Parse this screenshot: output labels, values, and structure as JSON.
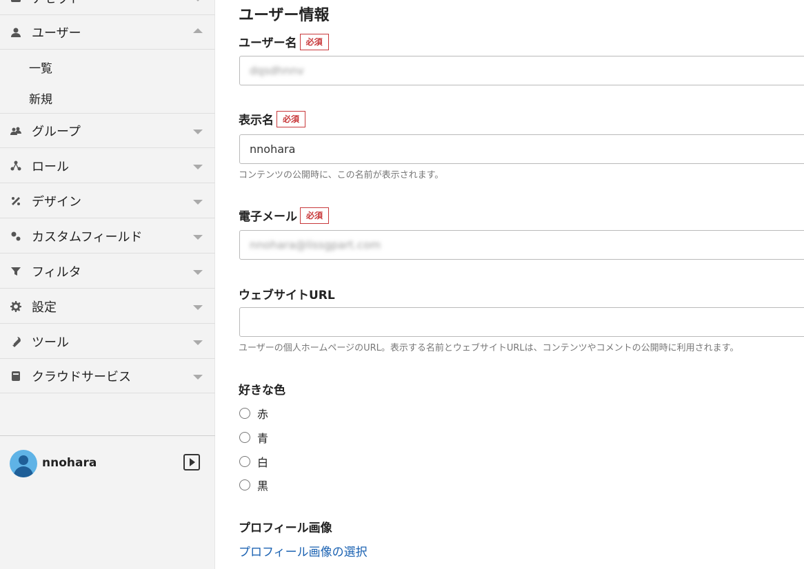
{
  "sidebar": {
    "top_item": {
      "label": "アセット"
    },
    "users": {
      "label": "ユーザー",
      "sub": [
        "一覧",
        "新規"
      ]
    },
    "items": [
      {
        "label": "グループ",
        "icon": "group-icon"
      },
      {
        "label": "ロール",
        "icon": "role-icon"
      },
      {
        "label": "デザイン",
        "icon": "design-icon"
      },
      {
        "label": "カスタムフィールド",
        "icon": "custom-field-icon"
      },
      {
        "label": "フィルタ",
        "icon": "filter-icon"
      },
      {
        "label": "設定",
        "icon": "gear-icon"
      },
      {
        "label": "ツール",
        "icon": "wrench-icon"
      },
      {
        "label": "クラウドサービス",
        "icon": "cloud-service-icon"
      }
    ],
    "user": {
      "name": "nnohara"
    }
  },
  "main": {
    "section_title": "ユーザー情報",
    "required_badge": "必須",
    "username": {
      "label": "ユーザー名",
      "value": "dqsdhnnv"
    },
    "display_name": {
      "label": "表示名",
      "value": "nnohara",
      "help": "コンテンツの公開時に、この名前が表示されます。"
    },
    "email": {
      "label": "電子メール",
      "value": "nnohara@lissgpart.com"
    },
    "website": {
      "label": "ウェブサイトURL",
      "value": "",
      "help": "ユーザーの個人ホームページのURL。表示する名前とウェブサイトURLは、コンテンツやコメントの公開時に利用されます。"
    },
    "color": {
      "label": "好きな色",
      "options": [
        "赤",
        "青",
        "白",
        "黒"
      ]
    },
    "profile_image": {
      "label": "プロフィール画像",
      "link": "プロフィール画像の選択"
    }
  }
}
